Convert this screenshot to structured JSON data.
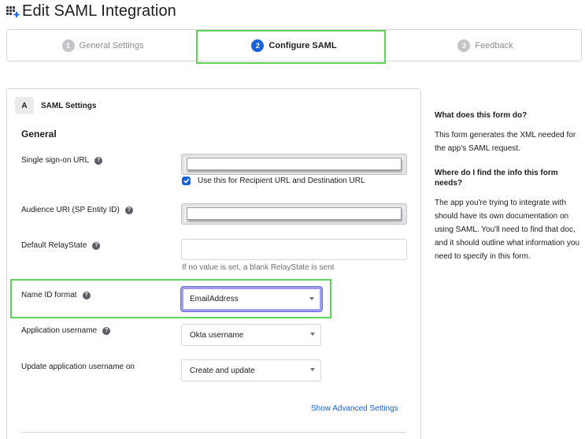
{
  "page": {
    "title": "Edit SAML Integration",
    "icon": "app-grid-add-icon"
  },
  "wizard": {
    "steps": [
      {
        "num": "1",
        "label": "General Settings",
        "active": false
      },
      {
        "num": "2",
        "label": "Configure SAML",
        "active": true
      },
      {
        "num": "3",
        "label": "Feedback",
        "active": false
      }
    ]
  },
  "section": {
    "badge": "A",
    "title": "SAML Settings",
    "heading": "General"
  },
  "fields": {
    "sso_url": {
      "label": "Single sign-on URL",
      "value": ""
    },
    "recipient_checkbox": {
      "label": "Use this for Recipient URL and Destination URL",
      "checked": true
    },
    "audience_uri": {
      "label": "Audience URI (SP Entity ID)",
      "value": ""
    },
    "relay_state": {
      "label": "Default RelayState",
      "value": "",
      "hint": "If no value is set, a blank RelayState is sent"
    },
    "name_id_format": {
      "label": "Name ID format",
      "value": "EmailAddress"
    },
    "app_username": {
      "label": "Application username",
      "value": "Okta username"
    },
    "update_username_on": {
      "label": "Update application username on",
      "value": "Create and update"
    }
  },
  "links": {
    "advanced": "Show Advanced Settings"
  },
  "help": {
    "q1": "What does this form do?",
    "a1": "This form generates the XML needed for the app's SAML request.",
    "q2": "Where do I find the info this form needs?",
    "a2": "The app you're trying to integrate with should have its own documentation on using SAML. You'll need to find that doc, and it should outline what information you need to specify in this form."
  },
  "colors": {
    "accent": "#1662dd",
    "highlight": "#5fd35a",
    "focus_ring": "#9f9fec"
  }
}
